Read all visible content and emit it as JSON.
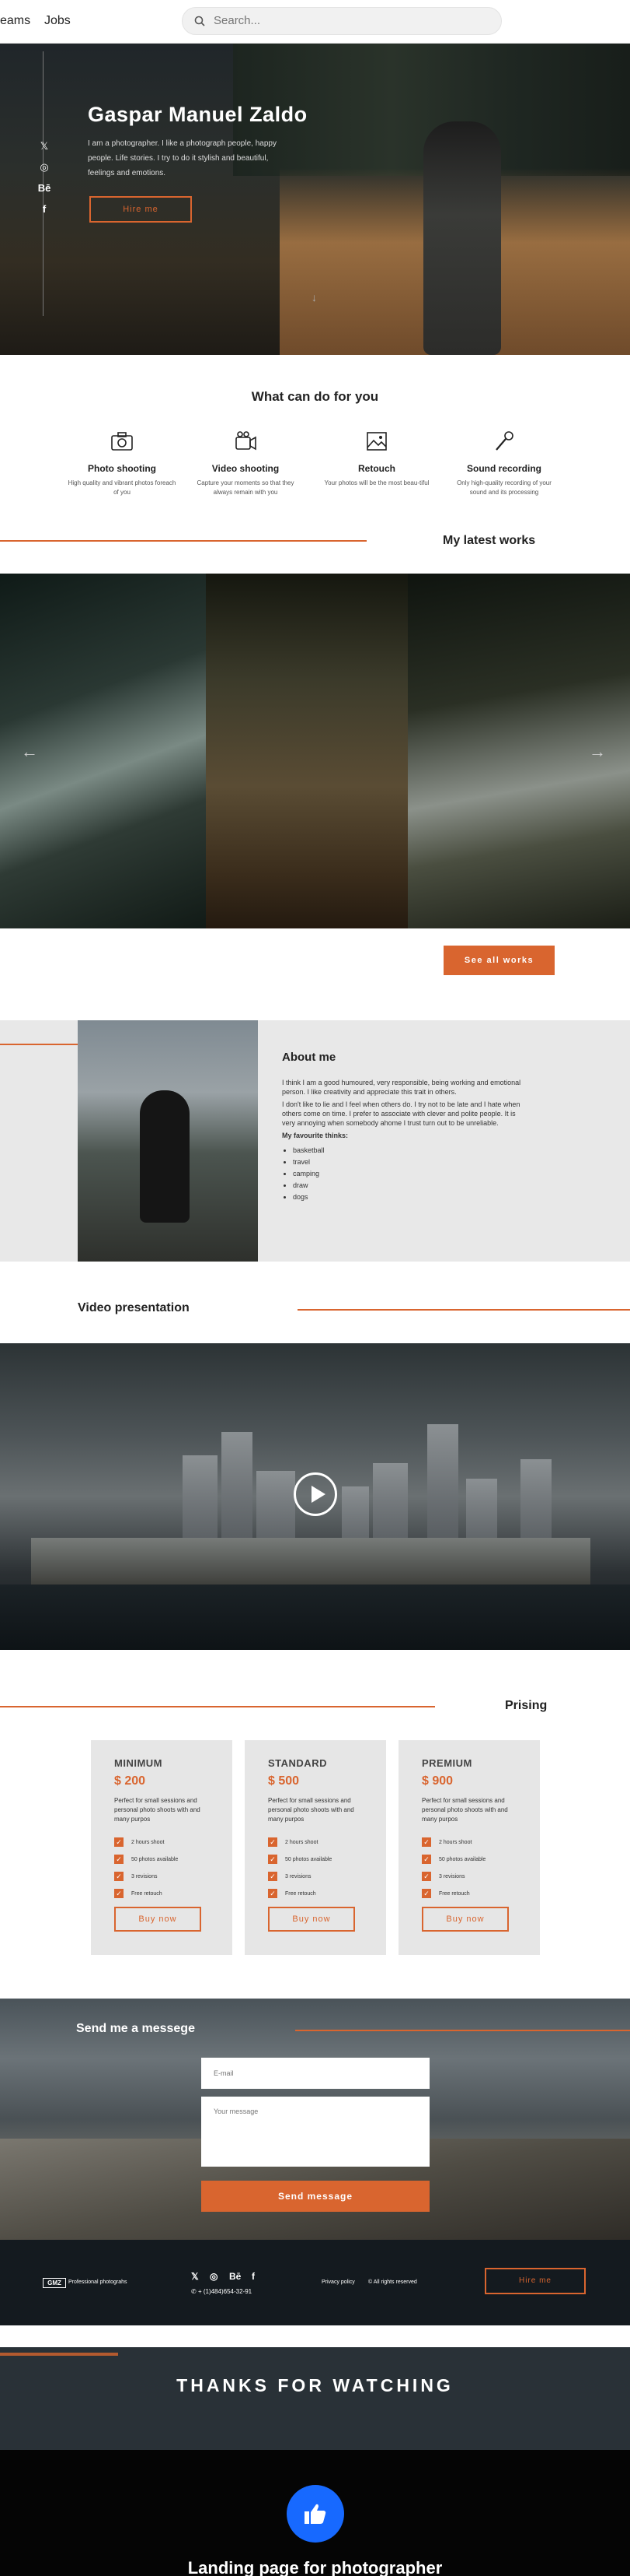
{
  "topbar": {
    "nav_items": [
      "eams",
      "Jobs"
    ],
    "search_placeholder": "Search..."
  },
  "hero": {
    "title": "Gaspar Manuel Zaldo",
    "intro": "I am a photographer. I like a photograph people, happy people. Life stories. I try to do it stylish and beautiful, feelings and emotions.",
    "hire_label": "Hire me",
    "social": [
      "twitter-icon",
      "instagram-icon",
      "behance-icon",
      "facebook-icon"
    ],
    "social_glyphs": [
      "𝕏",
      "◎",
      "Bē",
      "f"
    ],
    "scroll_glyph": "↓"
  },
  "services": {
    "title": "What can do for you",
    "items": [
      {
        "title": "Photo shooting",
        "desc": "High quality and vibrant photos foreach of you",
        "icon": "camera-icon"
      },
      {
        "title": "Video shooting",
        "desc": "Capture your moments so that they always remain with you",
        "icon": "video-camera-icon"
      },
      {
        "title": "Retouch",
        "desc": "Your photos will be the most beau-tiful",
        "icon": "image-icon"
      },
      {
        "title": "Sound recording",
        "desc": "Only high-quality recording of your sound and its processing",
        "icon": "microphone-icon"
      }
    ]
  },
  "works": {
    "title": "My latest works",
    "see_all_label": "See all works",
    "prev_glyph": "←",
    "next_glyph": "→"
  },
  "about": {
    "title": "About me",
    "paragraphs": [
      "I think I am a good humoured, very responsible, being working and emotional person. I like creativity and appreciate this trait in others.",
      "I don't like to lie and I feel when others do. I try not to be late and I hate when others come on time. I prefer to associate with clever and polite people. It is very annoying when somebody ahome I trust turn out to be unreliable."
    ],
    "fav_title": "My favourite thinks:",
    "favourites": [
      "basketball",
      "travel",
      "camping",
      "draw",
      "dogs"
    ]
  },
  "video": {
    "title": "Video presentation"
  },
  "pricing": {
    "title": "Prising",
    "plans": [
      {
        "name": "MINIMUM",
        "price": "$ 200",
        "desc": "Perfect for small sessions and personal photo shoots with and many purpos",
        "features": [
          "2 hours shoot",
          "50 photos available",
          "3 revisions",
          "Free retouch"
        ],
        "buy_label": "Buy now"
      },
      {
        "name": "STANDARD",
        "price": "$ 500",
        "desc": "Perfect for small sessions and personal photo shoots with and many purpos",
        "features": [
          "2 hours shoot",
          "50 photos available",
          "3 revisions",
          "Free retouch"
        ],
        "buy_label": "Buy now"
      },
      {
        "name": "PREMIUM",
        "price": "$ 900",
        "desc": "Perfect for small sessions and personal photo shoots with and many purpos",
        "features": [
          "2 hours shoot",
          "50 photos available",
          "3 revisions",
          "Free retouch"
        ],
        "buy_label": "Buy now"
      }
    ]
  },
  "message": {
    "title": "Send me a messege",
    "email_placeholder": "E-mail",
    "message_placeholder": "Your message",
    "send_label": "Send message"
  },
  "footer": {
    "logo": "GMZ",
    "tagline": "Professional photograhs",
    "social_glyphs": [
      "𝕏",
      "◎",
      "Bē",
      "f"
    ],
    "phone": "+ (1)484)654-32-91",
    "phone_glyph": "✆",
    "privacy": "Privacy policy",
    "rights": "© All rights reserved",
    "hire_label": "Hire me"
  },
  "thanks": {
    "title": "THANKS FOR WATCHING",
    "caption": "Landing page for photographer"
  },
  "colors": {
    "accent": "#d9652f",
    "like_button": "#1769ff",
    "footer_bg": "#141a1f"
  }
}
